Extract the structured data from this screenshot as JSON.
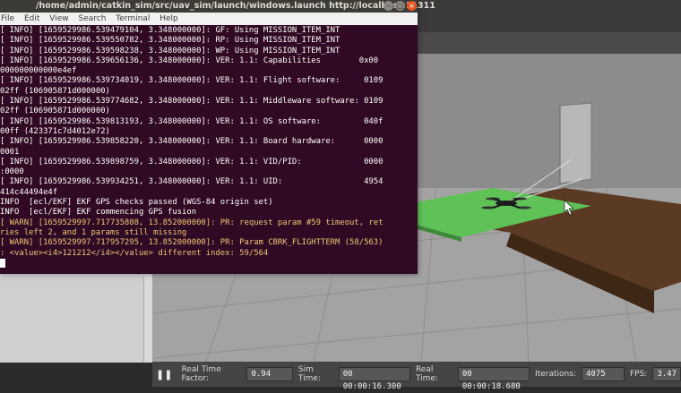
{
  "terminal": {
    "title": "/home/admin/catkin_sim/src/uav_sim/launch/windows.launch http://localhost:11311",
    "menu": [
      "File",
      "Edit",
      "View",
      "Search",
      "Terminal",
      "Help"
    ],
    "lines": [
      {
        "text": "[ INFO] [1659529986.539479104, 3.348000000]: GF: Using MISSION_ITEM_INT",
        "level": "info"
      },
      {
        "text": "[ INFO] [1659529986.539550782, 3.348000000]: RP: Using MISSION_ITEM_INT",
        "level": "info"
      },
      {
        "text": "[ INFO] [1659529986.539598238, 3.348000000]: WP: Using MISSION_ITEM_INT",
        "level": "info"
      },
      {
        "text": "[ INFO] [1659529986.539656136, 3.348000000]: VER: 1.1: Capabilities        0x00",
        "level": "info"
      },
      {
        "text": "000000000000e4ef",
        "level": "info"
      },
      {
        "text": "[ INFO] [1659529986.539734019, 3.348000000]: VER: 1.1: Flight software:     0109",
        "level": "info"
      },
      {
        "text": "02ff (106905871d000000)",
        "level": "info"
      },
      {
        "text": "[ INFO] [1659529986.539774682, 3.348000000]: VER: 1.1: Middleware software: 0109",
        "level": "info"
      },
      {
        "text": "02ff (106905871d000000)",
        "level": "info"
      },
      {
        "text": "[ INFO] [1659529986.539813193, 3.348000000]: VER: 1.1: OS software:         040f",
        "level": "info"
      },
      {
        "text": "00ff (423371c7d4012e72)",
        "level": "info"
      },
      {
        "text": "[ INFO] [1659529986.539858220, 3.348000000]: VER: 1.1: Board hardware:      0000",
        "level": "info"
      },
      {
        "text": "0001",
        "level": "info"
      },
      {
        "text": "[ INFO] [1659529986.539898759, 3.348000000]: VER: 1.1: VID/PID:             0000",
        "level": "info"
      },
      {
        "text": ":0000",
        "level": "info"
      },
      {
        "text": "[ INFO] [1659529986.539934251, 3.348000000]: VER: 1.1: UID:                 4954",
        "level": "info"
      },
      {
        "text": "414c44494e4f",
        "level": "info"
      },
      {
        "text": "INFO  [ecl/EKF] EKF GPS checks passed (WGS-84 origin set)",
        "level": "info"
      },
      {
        "text": "INFO  [ecl/EKF] EKF commencing GPS fusion",
        "level": "info"
      },
      {
        "text": "[ WARN] [1659529997.717735808, 13.852000000]: PR: request param #59 timeout, ret",
        "level": "warn"
      },
      {
        "text": "ries left 2, and 1 params still missing",
        "level": "warn"
      },
      {
        "text": "[ WARN] [1659529997.717957295, 13.852000000]: PR: Param CBRK_FLIGHTTERM (58/563)",
        "level": "warn"
      },
      {
        "text": ": <value><i4>121212</i4></value> different index: 59/564",
        "level": "warn"
      }
    ]
  },
  "status": {
    "real_time_factor_label": "Real Time Factor:",
    "real_time_factor": "0.94",
    "sim_time_label": "Sim Time:",
    "sim_time": "00 00:00:16.300",
    "real_time_label": "Real Time:",
    "real_time": "00 00:00:18.680",
    "iterations_label": "Iterations:",
    "iterations": "4075",
    "fps_label": "FPS:",
    "fps": "3.47"
  }
}
